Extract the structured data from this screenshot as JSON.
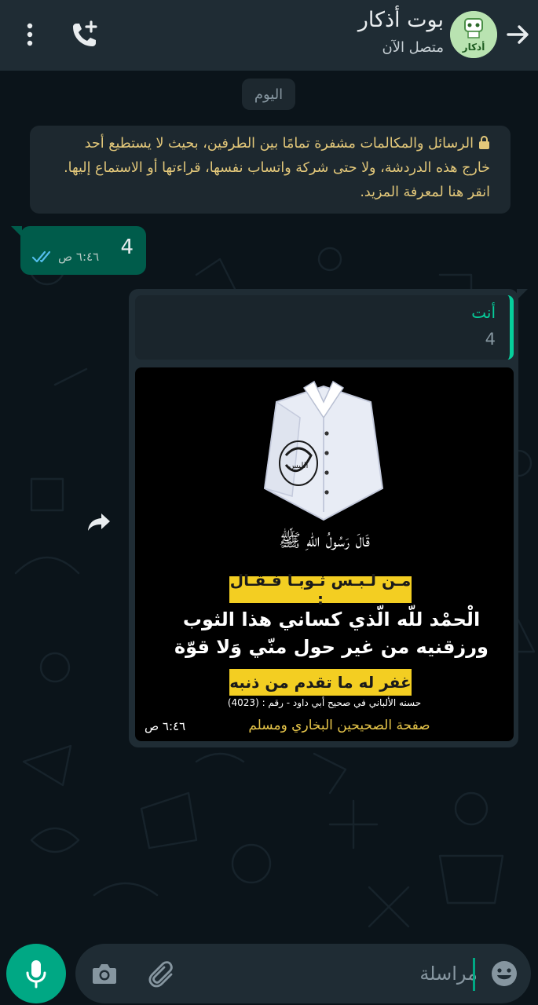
{
  "header": {
    "contact_name": "بوت أذكار",
    "status": "متصل الآن",
    "avatar_text": "أذكار"
  },
  "chat": {
    "date_chip": "اليوم",
    "encryption_notice": "الرسائل والمكالمات مشفرة تمامًا بين الطرفين، بحيث لا يستطيع أحد خارج هذه الدردشة، ولا حتى شركة واتساب نفسها، قراءتها أو الاستماع إليها. انقر هنا لمعرفة المزيد.",
    "outgoing": {
      "text": "4",
      "time": "٦:٤٦ ص",
      "status": "read"
    },
    "incoming": {
      "quote_author": "أنت",
      "quote_text": "4",
      "image": {
        "shirt_calligraphy": "اللبس",
        "saying": "قَالَ رَسُولُ اللهِ ﷺ",
        "tag_top": "مـن لـبـس ثـوبـا فـقـال :",
        "hadith": "الْحمْد للّه الّذي كساني هذا الثوب ورزقنيه من غير حول منّي وَلا قوّة",
        "tag_bottom": "غفر له ما تقدم من ذنبه",
        "source": "حسنه الألباني في صحيح أبي داود - رقم : (4023)",
        "page_name": "صفحة الصحيحين البخاري ومسلم"
      },
      "time": "٦:٤٦ ص"
    }
  },
  "composer": {
    "placeholder": "مراسلة"
  },
  "colors": {
    "header_bg": "#1f2c34",
    "chat_bg": "#0b141a",
    "outgoing_bubble": "#005c4b",
    "incoming_bubble": "#1f2c34",
    "accent": "#00a884",
    "notice_text": "#e3c87a",
    "tag_yellow": "#f3ce22"
  },
  "icons": [
    "arrow-right-icon",
    "phone-plus-icon",
    "more-vert-icon",
    "lock-icon",
    "double-check-icon",
    "forward-icon",
    "mic-icon",
    "camera-icon",
    "paperclip-icon",
    "emoji-icon"
  ]
}
